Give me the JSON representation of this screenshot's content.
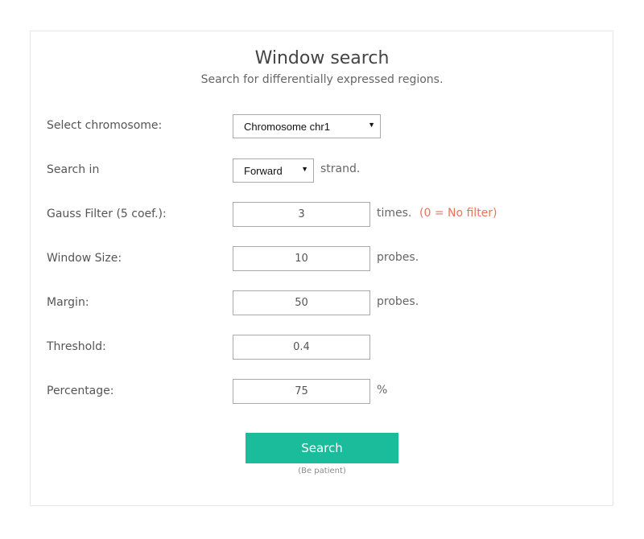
{
  "header": {
    "title": "Window search",
    "subtitle": "Search for differentially expressed regions."
  },
  "form": {
    "chromosome": {
      "label": "Select chromosome:",
      "value": "Chromosome chr1"
    },
    "strand": {
      "label": "Search in",
      "value": "Forward",
      "suffix": "strand."
    },
    "gauss": {
      "label": "Gauss Filter (5 coef.):",
      "value": "3",
      "suffix": "times.",
      "note": "(0 = No filter)"
    },
    "window_size": {
      "label": "Window Size:",
      "value": "10",
      "suffix": "probes."
    },
    "margin": {
      "label": "Margin:",
      "value": "50",
      "suffix": "probes."
    },
    "threshold": {
      "label": "Threshold:",
      "value": "0.4"
    },
    "percentage": {
      "label": "Percentage:",
      "value": "75",
      "suffix": "%"
    }
  },
  "actions": {
    "search_label": "Search",
    "hint": "(Be patient)"
  },
  "colors": {
    "accent": "#1abc9c",
    "note": "#e8725c"
  },
  "icons": {
    "dropdown": "chevron-down-icon"
  }
}
